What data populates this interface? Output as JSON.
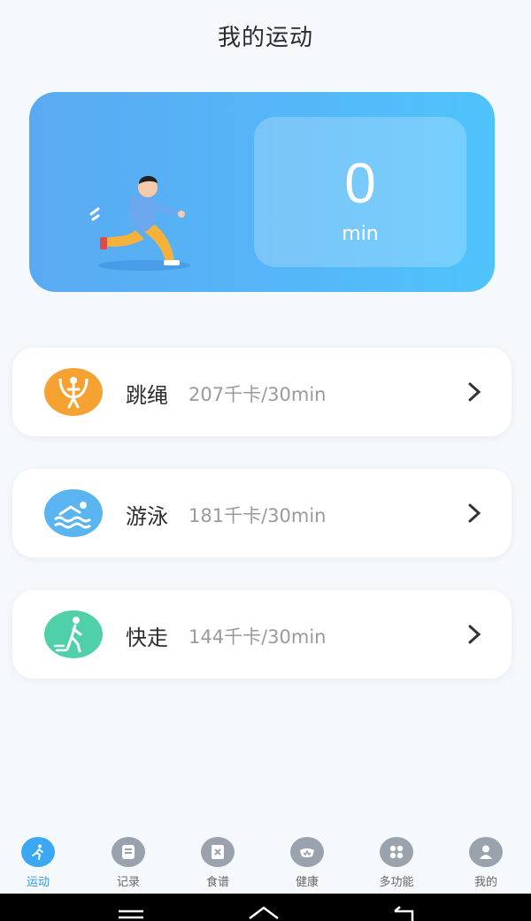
{
  "header": {
    "title": "我的运动"
  },
  "hero": {
    "value": "0",
    "unit": "min"
  },
  "activities": [
    {
      "name": "跳绳",
      "detail": "207千卡/30min",
      "icon": "jump-rope-icon",
      "color": "#f6a233"
    },
    {
      "name": "游泳",
      "detail": "181千卡/30min",
      "icon": "swim-icon",
      "color": "#5ab4ef"
    },
    {
      "name": "快走",
      "detail": "144千卡/30min",
      "icon": "walk-icon",
      "color": "#4fd0a8"
    }
  ],
  "tabs": [
    {
      "label": "运动",
      "icon": "run-icon",
      "active": true
    },
    {
      "label": "记录",
      "icon": "record-icon",
      "active": false
    },
    {
      "label": "食谱",
      "icon": "recipe-icon",
      "active": false
    },
    {
      "label": "健康",
      "icon": "health-icon",
      "active": false
    },
    {
      "label": "多功能",
      "icon": "grid-icon",
      "active": false
    },
    {
      "label": "我的",
      "icon": "person-icon",
      "active": false
    }
  ],
  "colors": {
    "accent": "#3aa8f2",
    "hero_gradient_start": "#5aaaf1",
    "hero_gradient_end": "#4fc3fb"
  }
}
